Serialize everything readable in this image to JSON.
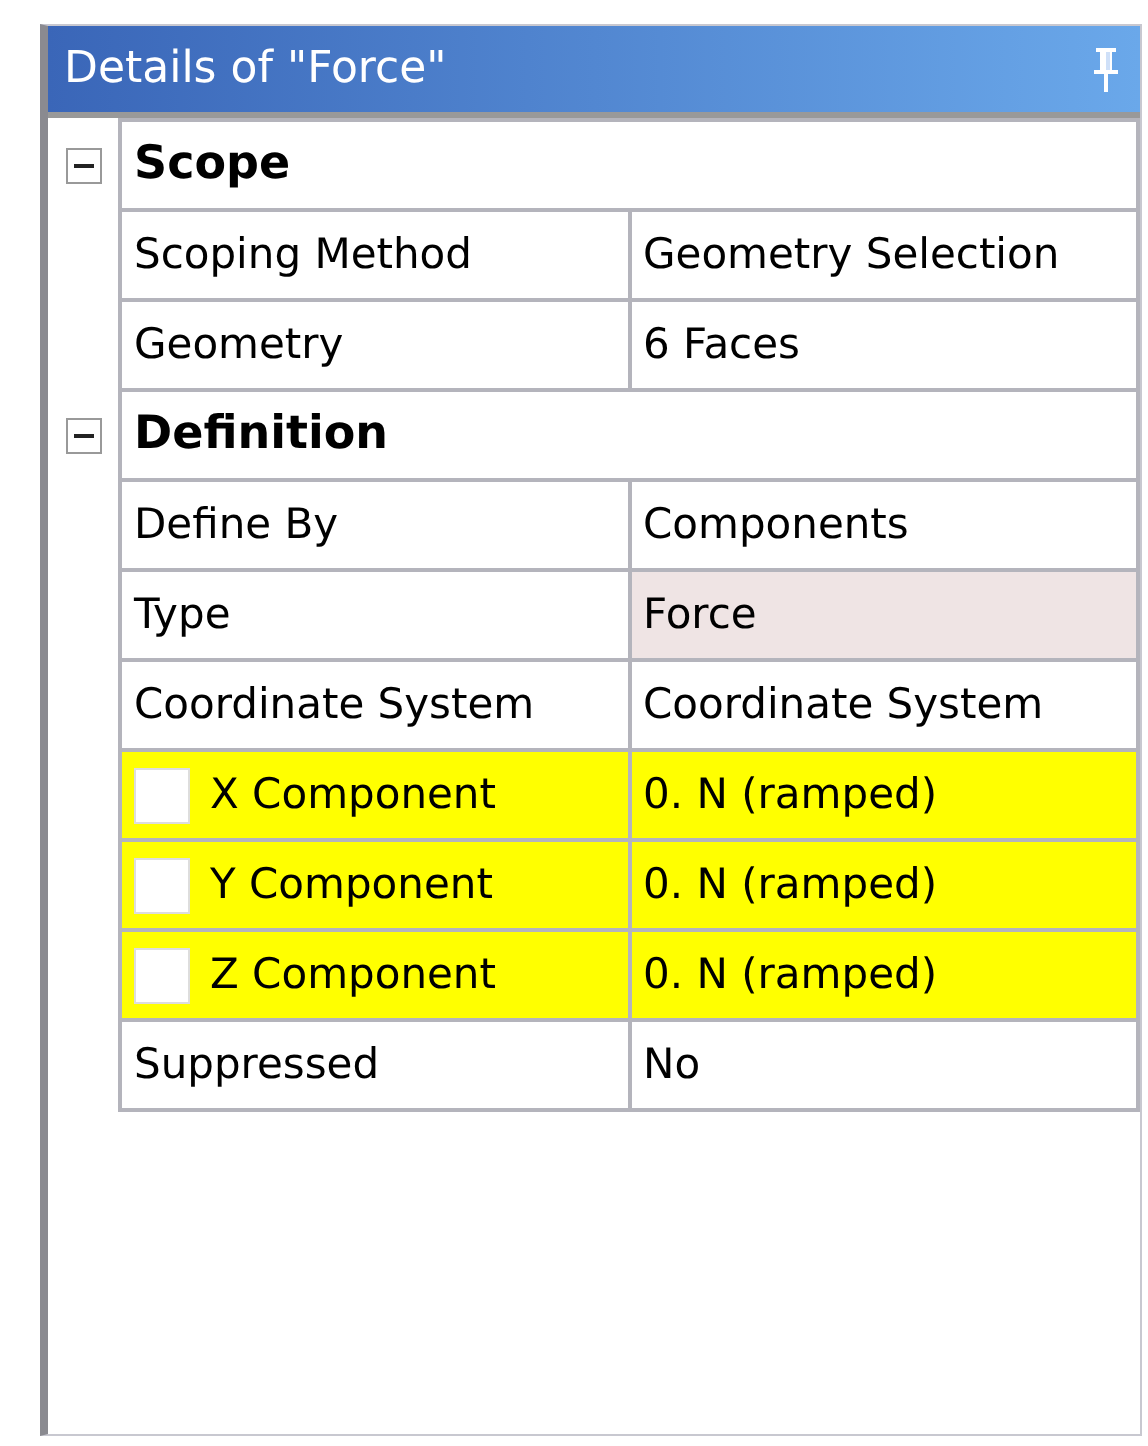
{
  "window": {
    "title": "Details of \"Force\"",
    "pinned": true
  },
  "sections": [
    {
      "title": "Scope",
      "expanded": true,
      "rows": [
        {
          "kind": "plain",
          "label": "Scoping Method",
          "value": "Geometry Selection",
          "highlighted": false,
          "read_only": false
        },
        {
          "kind": "plain",
          "label": "Geometry",
          "value": "6 Faces",
          "highlighted": false,
          "read_only": false
        }
      ]
    },
    {
      "title": "Definition",
      "expanded": true,
      "rows": [
        {
          "kind": "plain",
          "label": "Define By",
          "value": "Components",
          "highlighted": false,
          "read_only": false
        },
        {
          "kind": "plain",
          "label": "Type",
          "value": "Force",
          "highlighted": false,
          "read_only": true
        },
        {
          "kind": "plain",
          "label": "Coordinate System",
          "value": "Coordinate System",
          "highlighted": false,
          "read_only": false
        },
        {
          "kind": "checkbox",
          "checked": false,
          "label": "X Component",
          "value": "0. N (ramped)",
          "highlighted": true,
          "read_only": false
        },
        {
          "kind": "checkbox",
          "checked": false,
          "label": "Y Component",
          "value": "0. N (ramped)",
          "highlighted": true,
          "read_only": false
        },
        {
          "kind": "checkbox",
          "checked": false,
          "label": "Z Component",
          "value": "0. N (ramped)",
          "highlighted": true,
          "read_only": false
        },
        {
          "kind": "plain",
          "label": "Suppressed",
          "value": "No",
          "highlighted": false,
          "read_only": false
        }
      ]
    }
  ]
}
